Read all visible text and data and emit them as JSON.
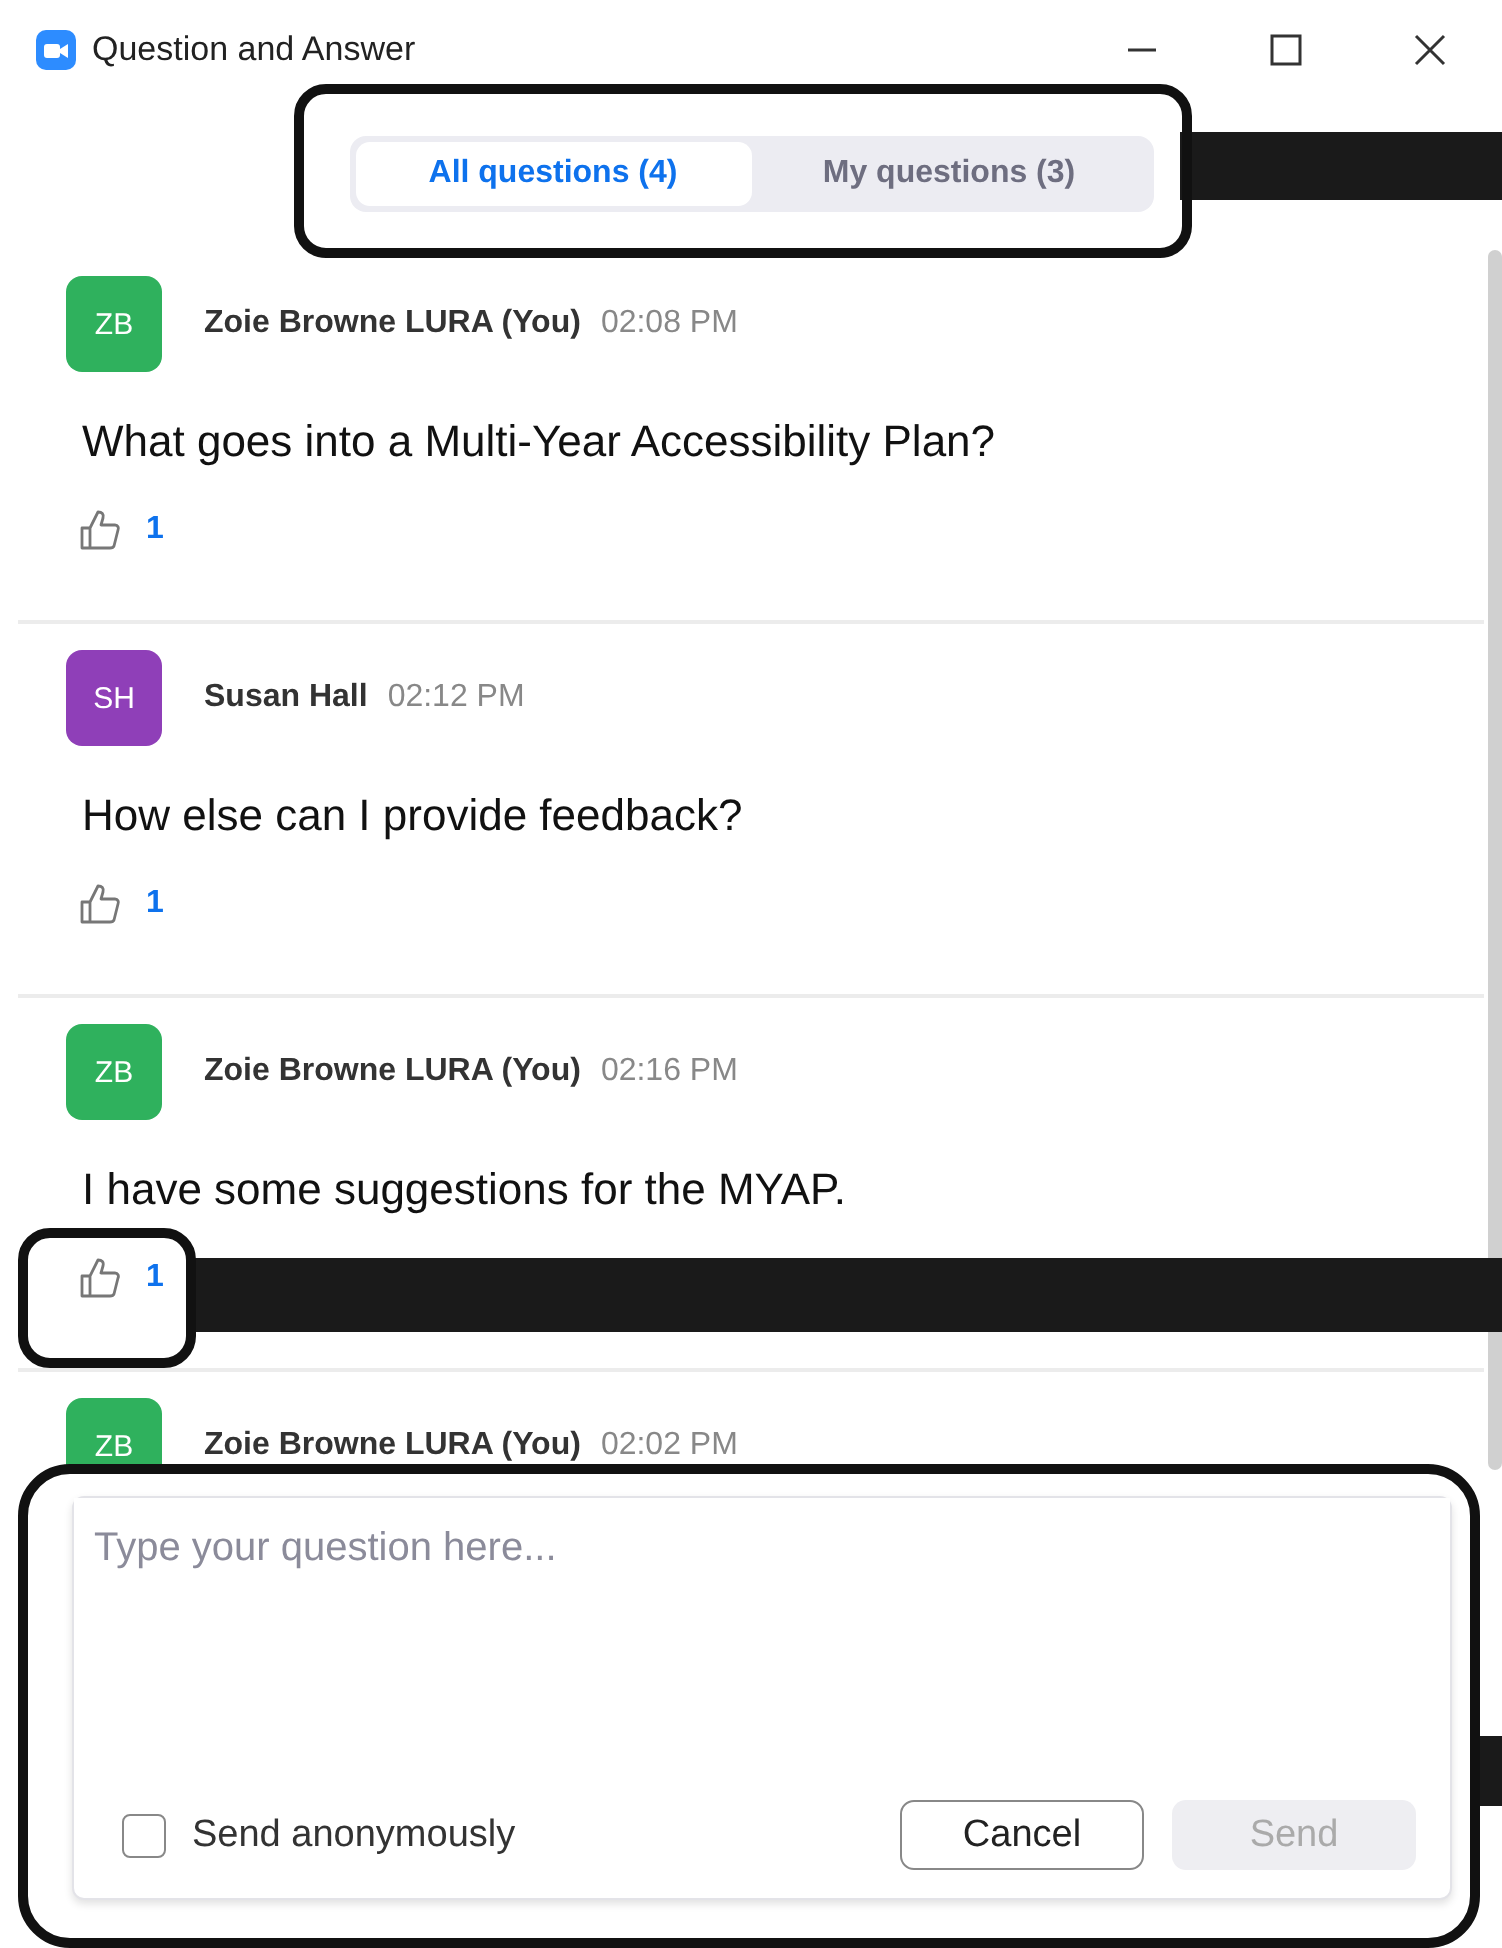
{
  "window": {
    "title": "Question and Answer"
  },
  "tabs": [
    {
      "label": "All questions (4)",
      "selected": true
    },
    {
      "label": "My questions (3)",
      "selected": false
    }
  ],
  "questions": [
    {
      "initials": "ZB",
      "color": "#2fb15d",
      "author": "Zoie Browne LURA (You)",
      "time": "02:08 PM",
      "text": "What goes into a Multi-Year Accessibility Plan?",
      "likes": "1"
    },
    {
      "initials": "SH",
      "color": "#8f3fb8",
      "author": "Susan Hall",
      "time": "02:12 PM",
      "text": "How else can I provide feedback?",
      "likes": "1"
    },
    {
      "initials": "ZB",
      "color": "#2fb15d",
      "author": "Zoie Browne LURA (You)",
      "time": "02:16 PM",
      "text": "I have some suggestions for the MYAP.",
      "likes": "1"
    },
    {
      "initials": "ZB",
      "color": "#2fb15d",
      "author": "Zoie Browne LURA (You)",
      "time": "02:02 PM"
    }
  ],
  "compose": {
    "placeholder": "Type your question here...",
    "anonymous": {
      "label": "Send anonymously",
      "checked": false
    },
    "cancel": "Cancel",
    "send": {
      "label": "Send",
      "disabled": true
    }
  }
}
